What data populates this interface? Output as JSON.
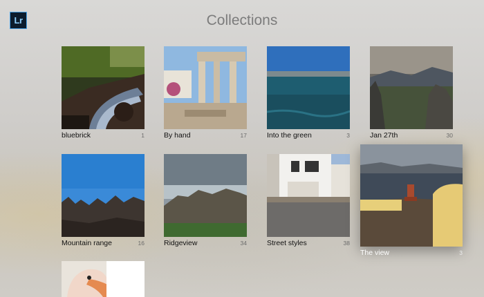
{
  "app": {
    "logo_text": "Lr"
  },
  "header": {
    "title": "Collections"
  },
  "collections": [
    {
      "name": "bluebrick",
      "count": "1"
    },
    {
      "name": "By hand",
      "count": "17"
    },
    {
      "name": "Into the green",
      "count": "3"
    },
    {
      "name": "Jan 27th",
      "count": "30"
    },
    {
      "name": "Mountain range",
      "count": "16"
    },
    {
      "name": "Ridgeview",
      "count": "34"
    },
    {
      "name": "Street styles",
      "count": "38"
    },
    {
      "name": "The view",
      "count": "3"
    }
  ],
  "colors": {
    "logo_bg": "#0c1c2d",
    "logo_accent": "#4aa3e8",
    "title": "#7c7c7c"
  }
}
